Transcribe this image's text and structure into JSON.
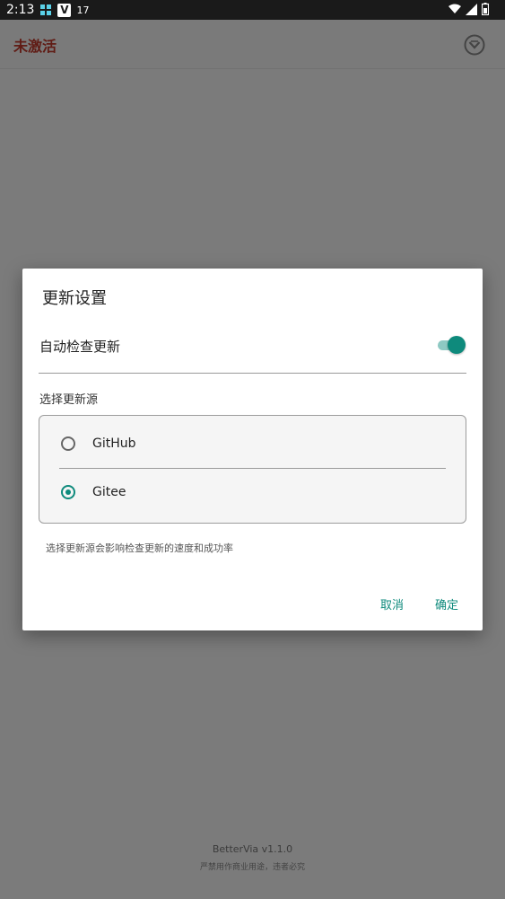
{
  "status_bar": {
    "time": "2:13",
    "temp": "17",
    "icons": [
      "app-icon",
      "v-icon",
      "wifi-icon",
      "signal-icon",
      "battery-icon"
    ]
  },
  "app_bar": {
    "title": "未激活",
    "title_color": "#c0392b",
    "icon": "shield-chevron-icon"
  },
  "background": {
    "version": "BetterVia v1.1.0",
    "note": "严禁用作商业用途，违者必究"
  },
  "dialog": {
    "title": "更新设置",
    "auto_check": {
      "label": "自动检查更新",
      "enabled": true
    },
    "source_section": {
      "label": "选择更新源",
      "options": [
        {
          "label": "GitHub",
          "selected": false
        },
        {
          "label": "Gitee",
          "selected": true
        }
      ]
    },
    "helper": "选择更新源会影响检查更新的速度和成功率",
    "buttons": {
      "cancel": "取消",
      "ok": "确定"
    },
    "accent_color": "#0e8a7c"
  }
}
